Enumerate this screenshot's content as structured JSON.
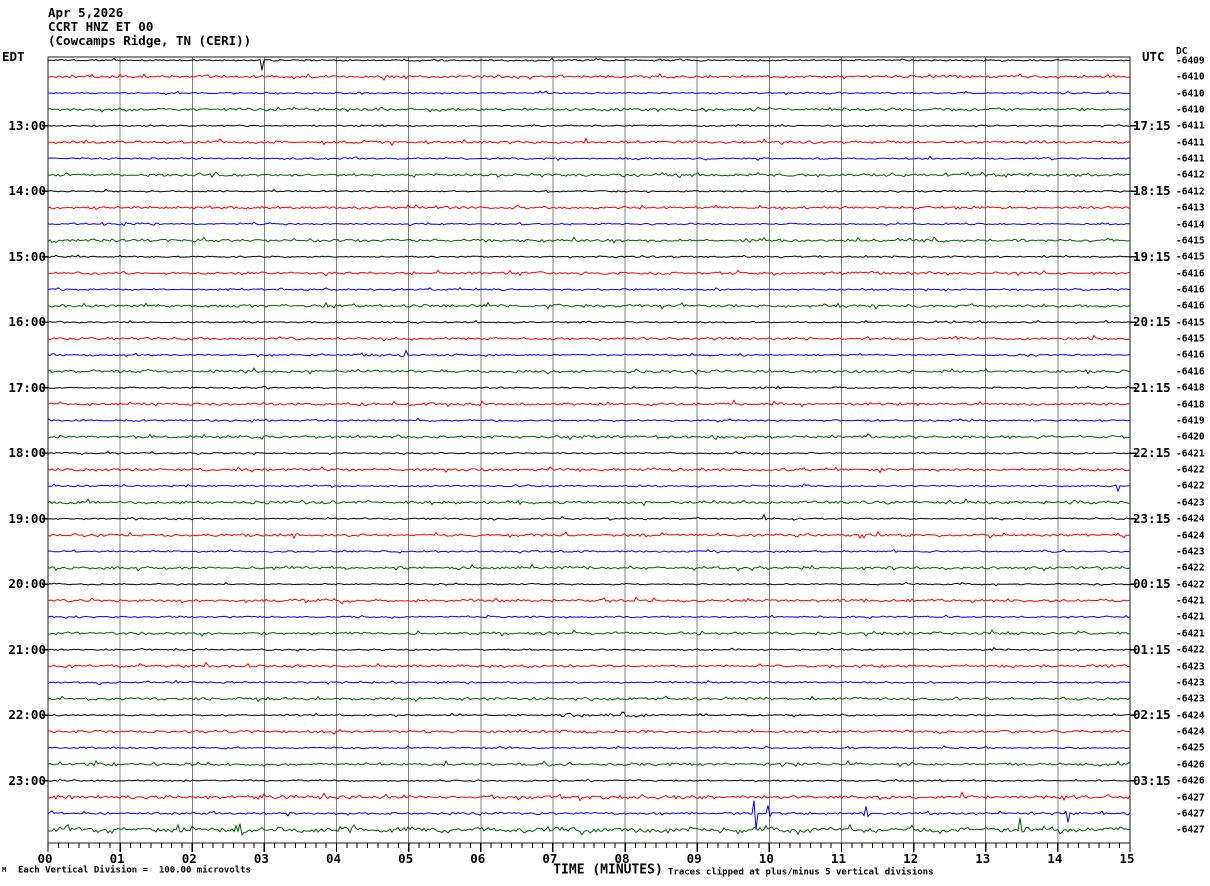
{
  "header": {
    "date": "Apr 5,2026",
    "station": "CCRT HNZ ET 00",
    "location": "(Cowcamps Ridge, TN (CERI))"
  },
  "axes": {
    "left_label": "EDT",
    "right_label": "UTC",
    "dc_label": "DC",
    "x_title": "TIME (MINUTES)",
    "footer_scale": "Each Vertical Division =  100.00 microvolts",
    "footer_clip": "Traces clipped at plus/minus 5 vertical divisions",
    "footer_margin_glyph": "M"
  },
  "chart_data": {
    "type": "line",
    "subtype": "helicorder-seismogram",
    "xlabel": "TIME (MINUTES)",
    "x_range_minutes": [
      0,
      15
    ],
    "x_tick_labels": [
      "00",
      "01",
      "02",
      "03",
      "04",
      "05",
      "06",
      "07",
      "08",
      "09",
      "10",
      "11",
      "12",
      "13",
      "14",
      "15"
    ],
    "minutes_per_row": 15,
    "row_count": 48,
    "grid": true,
    "grid_color": "#808080",
    "frame_color": "#1a1a1a",
    "colors_cycle": [
      "#000000",
      "#ff0000",
      "#0000ff",
      "#006400"
    ],
    "default_amp_by_color": {
      "#000000": 0.55,
      "#ff0000": 0.95,
      "#0000ff": 0.6,
      "#006400": 1.0
    },
    "rows": [
      {
        "dc": -6409,
        "spikes": [
          {
            "m": 2.95,
            "up": 1,
            "down": 10
          }
        ]
      },
      {
        "dc": -6410
      },
      {
        "dc": -6410
      },
      {
        "dc": -6410
      },
      {
        "dc": -6411,
        "edt": "13:00",
        "utc": "17:15"
      },
      {
        "dc": -6411
      },
      {
        "dc": -6411
      },
      {
        "dc": -6412
      },
      {
        "dc": -6412,
        "edt": "14:00",
        "utc": "18:15"
      },
      {
        "dc": -6413
      },
      {
        "dc": -6414,
        "bursts": [
          {
            "a": 0.7,
            "b": 1.6,
            "amp": 1.0
          }
        ]
      },
      {
        "dc": -6415
      },
      {
        "dc": -6415,
        "edt": "15:00",
        "utc": "19:15"
      },
      {
        "dc": -6416
      },
      {
        "dc": -6416
      },
      {
        "dc": -6416
      },
      {
        "dc": -6415,
        "edt": "16:00",
        "utc": "20:15"
      },
      {
        "dc": -6415
      },
      {
        "dc": -6416,
        "bursts": [
          {
            "a": 4.2,
            "b": 5.0,
            "amp": 1.5
          }
        ]
      },
      {
        "dc": -6416
      },
      {
        "dc": -6418,
        "edt": "17:00",
        "utc": "21:15"
      },
      {
        "dc": -6418
      },
      {
        "dc": -6419
      },
      {
        "dc": -6420
      },
      {
        "dc": -6421,
        "edt": "18:00",
        "utc": "22:15"
      },
      {
        "dc": -6422
      },
      {
        "dc": -6422,
        "spikes": [
          {
            "m": 14.8,
            "up": 1,
            "down": 5
          }
        ]
      },
      {
        "dc": -6423
      },
      {
        "dc": -6424,
        "edt": "19:00",
        "utc": "23:15",
        "spikes": [
          {
            "m": 9.93,
            "up": 4,
            "down": 1
          }
        ]
      },
      {
        "dc": -6424
      },
      {
        "dc": -6423
      },
      {
        "dc": -6422
      },
      {
        "dc": -6422,
        "edt": "20:00",
        "utc": "00:15"
      },
      {
        "dc": -6421
      },
      {
        "dc": -6421
      },
      {
        "dc": -6421
      },
      {
        "dc": -6422,
        "edt": "21:00",
        "utc": "01:15"
      },
      {
        "dc": -6423
      },
      {
        "dc": -6423
      },
      {
        "dc": -6423
      },
      {
        "dc": -6424,
        "edt": "22:00",
        "utc": "02:15",
        "bursts": [
          {
            "a": 7.0,
            "b": 8.4,
            "amp": 1.4
          }
        ]
      },
      {
        "dc": -6424,
        "bursts": [
          {
            "a": 7.0,
            "b": 8.4,
            "amp": 1.2
          }
        ]
      },
      {
        "dc": -6425
      },
      {
        "dc": -6426
      },
      {
        "dc": -6426,
        "edt": "23:00",
        "utc": "03:15"
      },
      {
        "dc": -6427,
        "amp": 1.25
      },
      {
        "dc": -6427,
        "amp": 0.8,
        "spikes": [
          {
            "m": 9.8,
            "up": 13,
            "down": 16
          },
          {
            "m": 9.97,
            "up": 8,
            "down": 3
          },
          {
            "m": 11.35,
            "up": 7,
            "down": 3
          },
          {
            "m": 14.1,
            "up": 2,
            "down": 9
          }
        ]
      },
      {
        "dc": -6427,
        "amp": 1.6,
        "wiggle": true,
        "spikes": [
          {
            "m": 2.66,
            "up": 6,
            "down": 5
          },
          {
            "m": 13.48,
            "up": 12,
            "down": 2
          }
        ]
      }
    ]
  }
}
